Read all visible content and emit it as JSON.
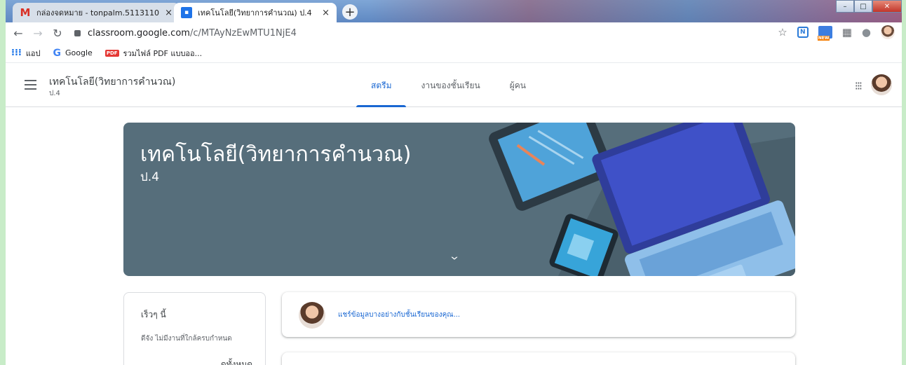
{
  "browser": {
    "tabs": [
      {
        "title": "กล่องจดหมาย - tonpalm.5113110",
        "favicon": "gmail-icon",
        "active": false
      },
      {
        "title": "เทคโนโลยี(วิทยาการคำนวณ) ป.4",
        "favicon": "classroom-icon",
        "active": true
      }
    ],
    "tab_close_glyph": "×",
    "new_tab_glyph": "+",
    "url_host": "classroom.google.com",
    "url_path": "/c/MTAyNzEwMTU1NjE4",
    "bookmarks": [
      {
        "label": "แอป",
        "icon": "apps-grid-icon"
      },
      {
        "label": "Google",
        "icon": "google-g-icon"
      },
      {
        "label": "รวมไฟล์ PDF แบบออ...",
        "icon": "pdf-icon"
      }
    ]
  },
  "classroom": {
    "class_name": "เทคโนโลยี(วิทยาการคำนวณ)",
    "section": "ป.4",
    "nav_tabs": [
      {
        "label": "สตรีม",
        "active": true
      },
      {
        "label": "งานของชั้นเรียน",
        "active": false
      },
      {
        "label": "ผู้คน",
        "active": false
      }
    ],
    "banner_title": "เทคโนโลยี(วิทยาการคำนวณ)",
    "banner_section": "ป.4",
    "banner_color": "#566e7b",
    "accent_color": "#1967d2",
    "upcoming": {
      "title": "เร็วๆ นี้",
      "body": "ดีจัง ไม่มีงานที่ใกล้ครบกำหนด",
      "view_all": "ดูทั้งหมด"
    },
    "share_prompt": "แชร์ข้อมูลบางอย่างกับชั้นเรียนของคุณ..."
  }
}
